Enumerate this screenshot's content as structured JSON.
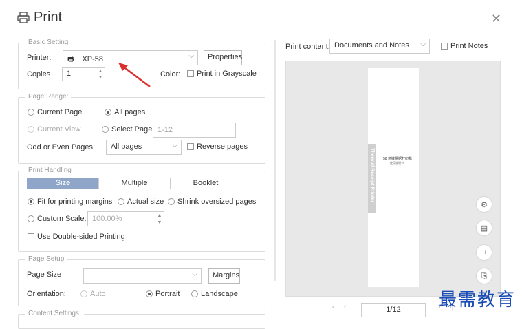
{
  "dialog": {
    "title": "Print",
    "icon": "printer-icon",
    "close_icon": "close-icon"
  },
  "basic": {
    "legend": "Basic Setting",
    "printer_label": "Printer:",
    "printer_value": "XP-58",
    "properties_button": "Properties",
    "copies_label": "Copies",
    "copies_value": "1",
    "color_label": "Color:",
    "grayscale_label": "Print in Grayscale",
    "grayscale_checked": false
  },
  "page_range": {
    "legend": "Page Range:",
    "current_page": "Current Page",
    "all_pages": "All pages",
    "all_pages_selected": true,
    "current_view": "Current View",
    "select_page": "Select Page:",
    "select_page_placeholder": "1-12",
    "odd_even_label": "Odd or Even Pages:",
    "odd_even_value": "All pages",
    "reverse_pages": "Reverse pages"
  },
  "print_handling": {
    "legend": "Print Handling",
    "tabs": [
      "Size",
      "Multiple",
      "Booklet"
    ],
    "active_tab": "Size",
    "fit_margins": "Fit for printing margins",
    "actual_size": "Actual size",
    "shrink_oversized": "Shrink oversized pages",
    "custom_scale": "Custom Scale:",
    "custom_scale_value": "100.00%",
    "double_sided": "Use Double-sided Printing"
  },
  "page_setup": {
    "legend": "Page Setup",
    "page_size_label": "Page Size",
    "page_size_value": "",
    "margins_button": "Margins",
    "orientation_label": "Orientation:",
    "auto": "Auto",
    "portrait": "Portrait",
    "landscape": "Landscape",
    "orientation_selected": "Portrait"
  },
  "content_settings": {
    "legend": "Content Settings:"
  },
  "preview": {
    "print_content_label": "Print content:",
    "print_content_value": "Documents and Notes",
    "print_notes_label": "Print Notes",
    "page_indicator": "1/12",
    "page_rotated_text": "Thermal Receipt Printer",
    "page_title_cn": "58 热敏票据打印机",
    "page_subtitle_cn": "使用说明书"
  },
  "watermark": "最需教育",
  "colors": {
    "accent": "#8fa6c9",
    "annotation_arrow": "#d9302c",
    "watermark": "#1a4db3"
  }
}
